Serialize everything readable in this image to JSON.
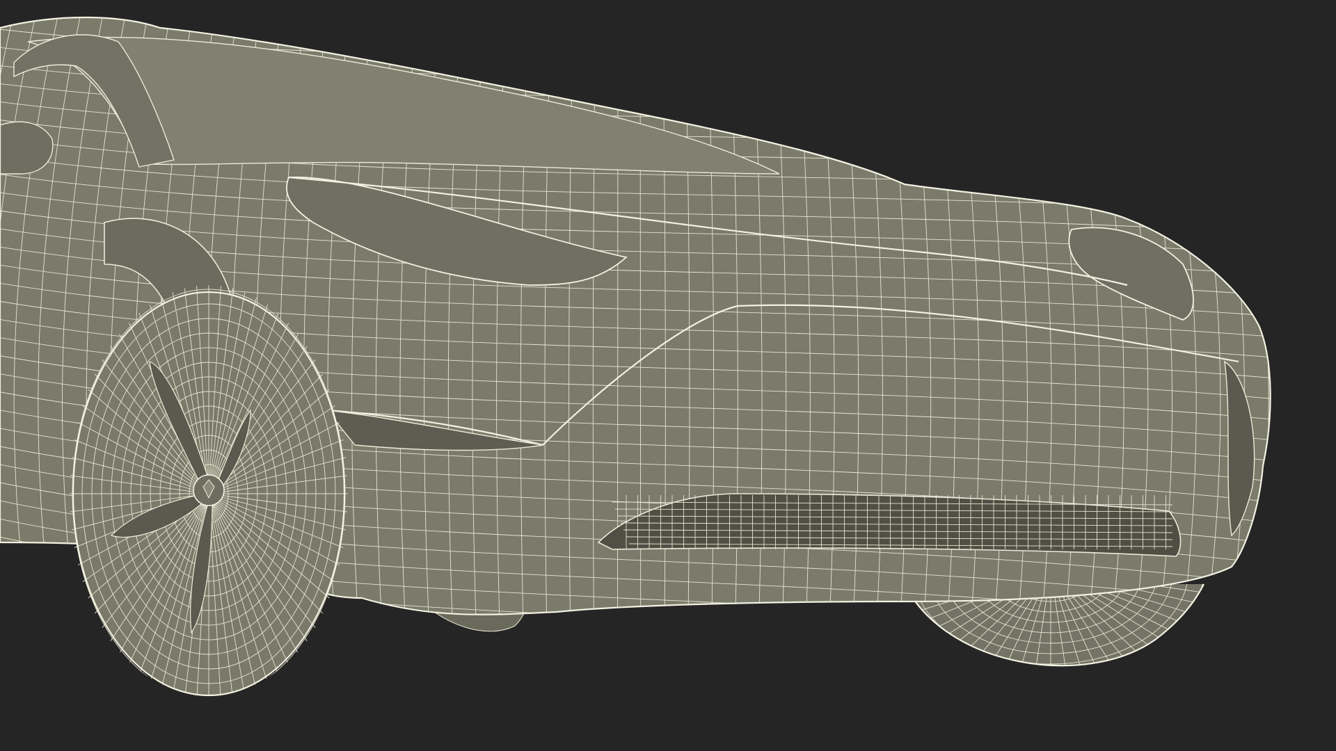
{
  "colors": {
    "background": "#252525",
    "body_fill": "#7b7b6b",
    "body_fill_dark": "#636356",
    "shadow_fill": "#545447",
    "wireframe": "#ecebd9"
  },
  "icons": {
    "subject": "car-wireframe-model"
  }
}
